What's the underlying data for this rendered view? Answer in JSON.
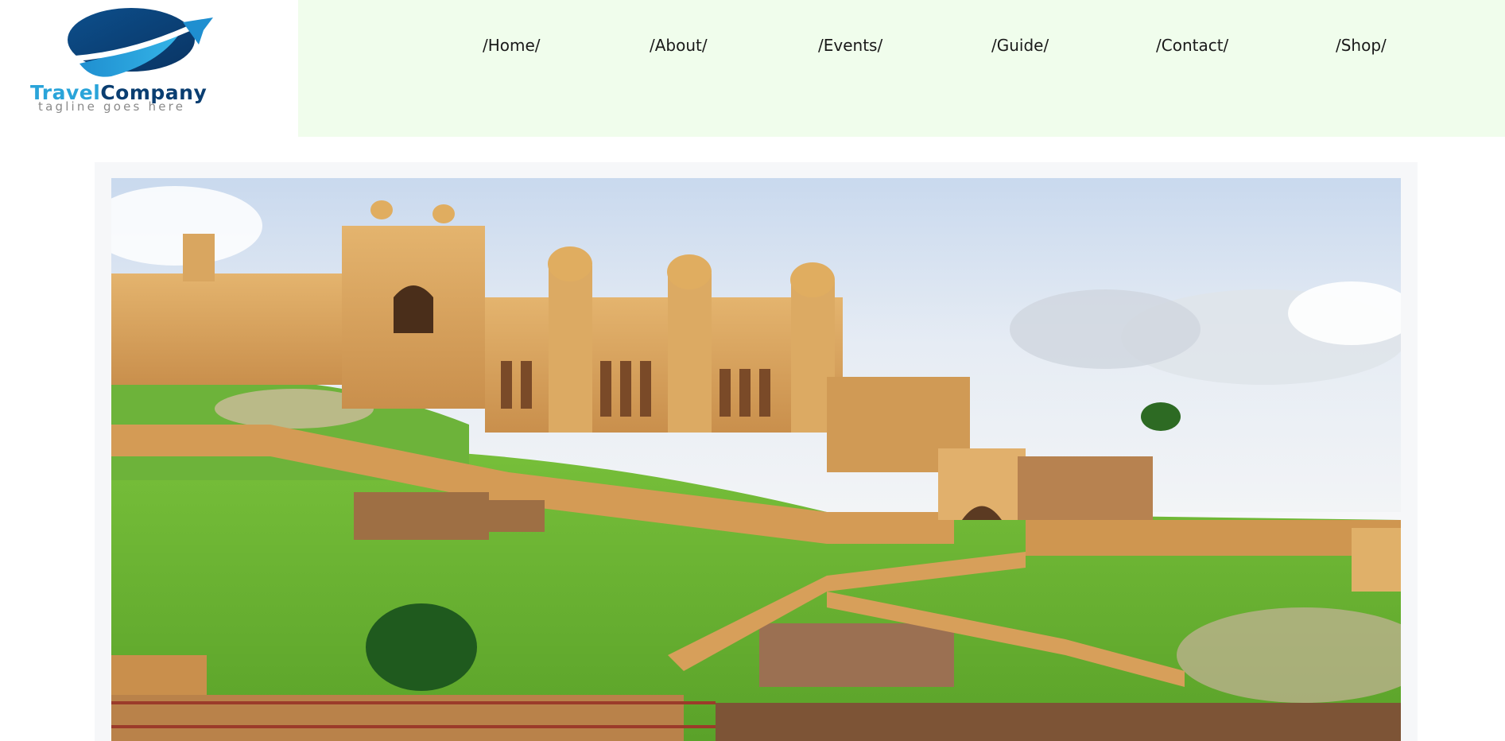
{
  "brand": {
    "word1": "Travel",
    "word2": "Company",
    "tagline": "tagline goes here",
    "colors": {
      "light_blue": "#2aa4d9",
      "dark_blue": "#0a3e71"
    }
  },
  "nav": {
    "background": "#f0fdec",
    "items": [
      {
        "label": "/Home/"
      },
      {
        "label": "/About/"
      },
      {
        "label": "/Events/"
      },
      {
        "label": "/Guide/"
      },
      {
        "label": "/Contact/"
      },
      {
        "label": "/Shop/"
      }
    ]
  },
  "hero": {
    "subject": "hilltop-fort-photo"
  }
}
